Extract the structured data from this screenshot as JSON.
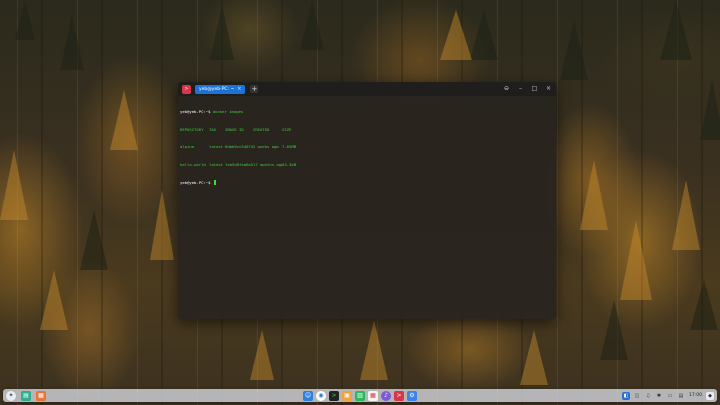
{
  "terminal": {
    "tab_title": "yeb@yeb-PC: ~",
    "tab_close": "×",
    "new_tab": "+",
    "window_buttons": {
      "menu": "⊖",
      "minimize": "–",
      "maximize": "□",
      "close": "×"
    },
    "lines": [
      {
        "prompt": "yeb@yeb-PC:~$ ",
        "command": "docker images"
      },
      {
        "cols": [
          "REPOSITORY",
          "TAG",
          "IMAGE ID",
          "CREATED",
          "SIZE"
        ]
      },
      {
        "cols": [
          "alpine",
          "latest",
          "6dbb9cc54074",
          "2 weeks ago",
          "7.05MB"
        ]
      },
      {
        "cols": [
          "hello-world",
          "latest",
          "feb5d9fea6a5",
          "17 months ago",
          "13.3kB"
        ]
      },
      {
        "prompt": "yeb@yeb-PC:~$ ",
        "command": ""
      }
    ]
  },
  "dock": {
    "left_icons": [
      "launcher-icon",
      "multitask-view-icon",
      "file-manager-icon"
    ],
    "center_icons": [
      "finder-icon",
      "browser-icon",
      "terminal-icon",
      "image-viewer-icon",
      "app-store-icon",
      "calendar-icon",
      "music-icon",
      "app-red-icon",
      "settings-icon"
    ],
    "right_icons": [
      "notifications-icon",
      "network-icon",
      "volume-icon",
      "bluetooth-icon",
      "battery-icon",
      "keyboard-icon"
    ],
    "clock": {
      "time": "17:00",
      "date": ""
    },
    "colors": {
      "accent": "#1a74d8",
      "terminal_green": "#3fcf3f",
      "app_red": "#d8364a"
    }
  }
}
